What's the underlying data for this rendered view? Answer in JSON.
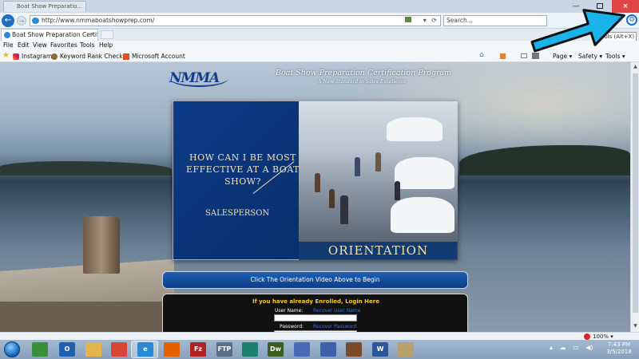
{
  "browser": {
    "background_tab_title": "Boat Show Preparatio...",
    "url": "http://www.nmmaboatshowprep.com/",
    "search_placeholder": "Search...",
    "active_tab_title": "Boat Show Preparation Certif...",
    "tab_close": "×",
    "tooltip": "Tools (Alt+X)",
    "window_minimize": "—",
    "window_maximize": "",
    "window_close": "×"
  },
  "menu": {
    "file": "File",
    "edit": "Edit",
    "view": "View",
    "favorites": "Favorites",
    "tools": "Tools",
    "help": "Help"
  },
  "favorites": [
    {
      "label": "Instagram"
    },
    {
      "label": "Keyword Rank Checker"
    },
    {
      "label": "Microsoft Account"
    }
  ],
  "commands": {
    "page": "Page ▾",
    "safety": "Safety ▾",
    "tools": "Tools ▾"
  },
  "page": {
    "logo": "NMMA",
    "title": "Boat Show Preparation Certification Program",
    "tagline": "A New Standard in Sales Excellence",
    "video": {
      "question": "How can I be most effective at a boat show?",
      "salesperson": "Salesperson",
      "orientation": "Orientation"
    },
    "begin_text": "Click The Orientation Video Above to Begin",
    "login": {
      "heading": "If you have already Enrolled, Login Here",
      "username_label": "User Name:",
      "recover_username": "Recover User Name",
      "password_label": "Password:",
      "recover_password": "Recover Password"
    }
  },
  "status": {
    "zoom": "100% ▾"
  },
  "taskbar": {
    "apps": [
      {
        "name": "excel-like",
        "label": "",
        "color": "#3a8f3a"
      },
      {
        "name": "outlook",
        "label": "O",
        "color": "#1f5fb0"
      },
      {
        "name": "file-explorer",
        "label": "",
        "color": "#e3b44a"
      },
      {
        "name": "chrome",
        "label": "",
        "color": "#db4437"
      },
      {
        "name": "internet-explorer",
        "label": "e",
        "color": "#2a8ad6"
      },
      {
        "name": "firefox",
        "label": "",
        "color": "#e66000"
      },
      {
        "name": "filezilla",
        "label": "Fz",
        "color": "#b22222"
      },
      {
        "name": "ftp-client",
        "label": "FTP",
        "color": "#5a6f86"
      },
      {
        "name": "publisher-like",
        "label": "",
        "color": "#1d7f6e"
      },
      {
        "name": "dreamweaver",
        "label": "Dw",
        "color": "#3b5e1f"
      },
      {
        "name": "app-blue-1",
        "label": "",
        "color": "#4a68b8"
      },
      {
        "name": "app-blue-2",
        "label": "",
        "color": "#3f5faa"
      },
      {
        "name": "library",
        "label": "",
        "color": "#7a4a2a"
      },
      {
        "name": "word",
        "label": "W",
        "color": "#2b579a"
      },
      {
        "name": "app-misc",
        "label": "",
        "color": "#b8a16a"
      }
    ],
    "time": "7:43 PM",
    "date": "3/5/2018"
  },
  "colors": {
    "nmma_blue": "#123e8c",
    "video_text": "#f2e2b1",
    "login_heading": "#ffcc00",
    "annotation_arrow": "#19b3ea"
  }
}
